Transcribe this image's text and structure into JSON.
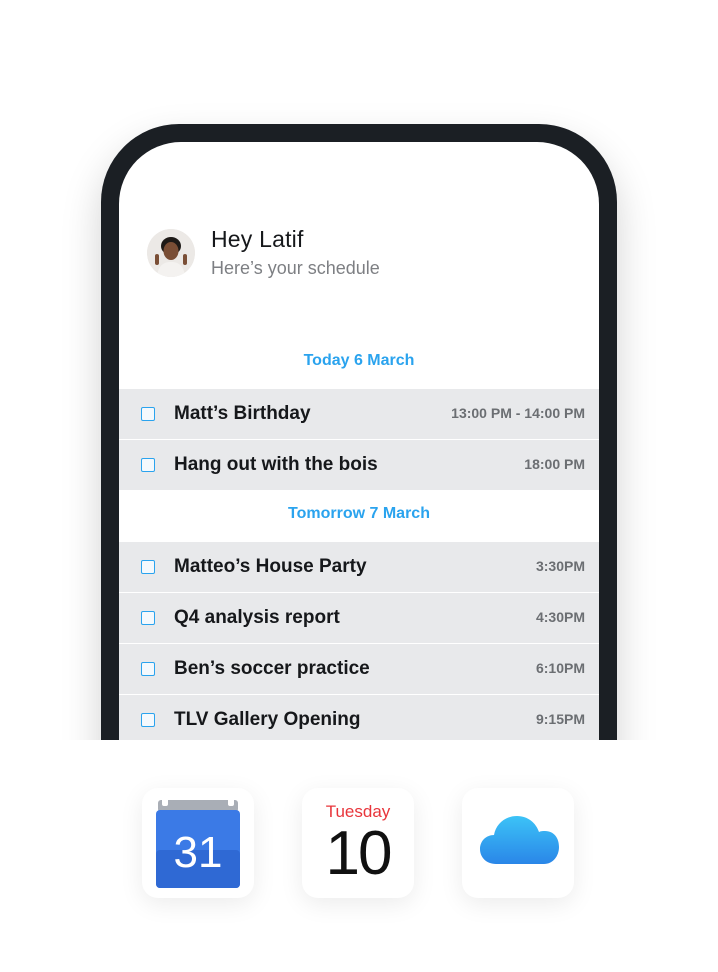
{
  "header": {
    "greeting": "Hey Latif",
    "subtitle": "Here’s your schedule",
    "avatar_icon": "user-avatar-icon"
  },
  "days": [
    {
      "label": "Today 6 March",
      "events": [
        {
          "title": "Matt’s Birthday",
          "time": "13:00 PM - 14:00 PM",
          "checked": false
        },
        {
          "title": "Hang out with the bois",
          "time": "18:00 PM",
          "checked": false
        }
      ]
    },
    {
      "label": "Tomorrow 7 March",
      "events": [
        {
          "title": "Matteo’s House Party",
          "time": "3:30PM",
          "checked": false
        },
        {
          "title": "Q4 analysis report",
          "time": "4:30PM",
          "checked": false
        },
        {
          "title": "Ben’s soccer practice",
          "time": "6:10PM",
          "checked": false
        },
        {
          "title": "TLV Gallery Opening",
          "time": "9:15PM",
          "checked": false
        }
      ]
    }
  ],
  "integrations": {
    "google_calendar": {
      "date": "31",
      "icon": "google-calendar-icon"
    },
    "apple_calendar": {
      "weekday": "Tuesday",
      "date": "10",
      "icon": "apple-calendar-icon"
    },
    "icloud": {
      "icon": "icloud-icon"
    }
  },
  "colors": {
    "accent": "#2aa3ee",
    "phone_frame": "#1b1f24",
    "row_bg": "#e8e9eb",
    "apple_red": "#e8353b",
    "google_blue": "#3b7ae6"
  }
}
